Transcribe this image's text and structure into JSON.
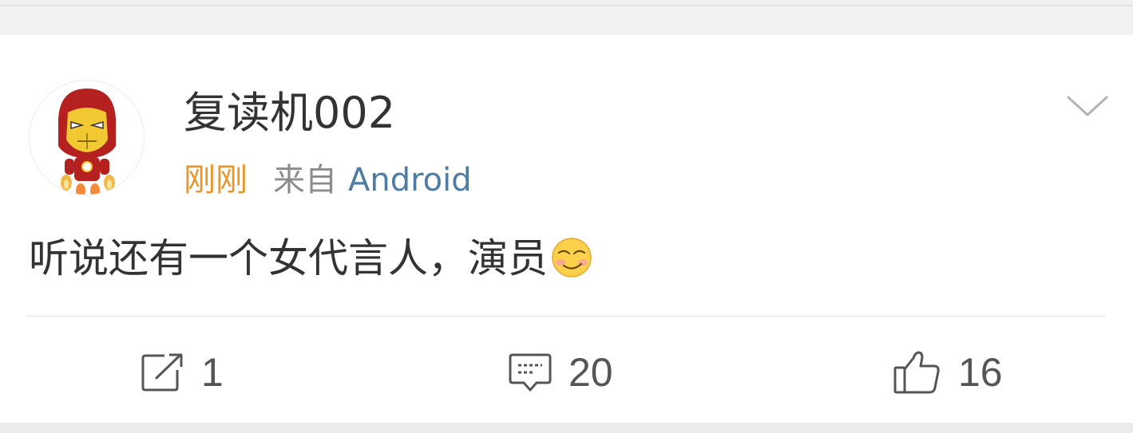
{
  "post": {
    "username": "复读机002",
    "time": "刚刚",
    "source_prefix": "来自",
    "source_device": "Android",
    "content_text": "听说还有一个女代言人，演员",
    "content_emoji": "smirk-emoji",
    "avatar": "iron-man-cartoon-avatar"
  },
  "actions": {
    "repost_count": "1",
    "comment_count": "20",
    "like_count": "16"
  },
  "colors": {
    "time": "#e8962a",
    "source": "#8c8c8c",
    "device_link": "#4e7ca3",
    "text": "#333333",
    "background": "#f1f1f1",
    "card": "#ffffff"
  },
  "icons": [
    "chevron-down-icon",
    "repost-icon",
    "comment-icon",
    "like-icon"
  ]
}
